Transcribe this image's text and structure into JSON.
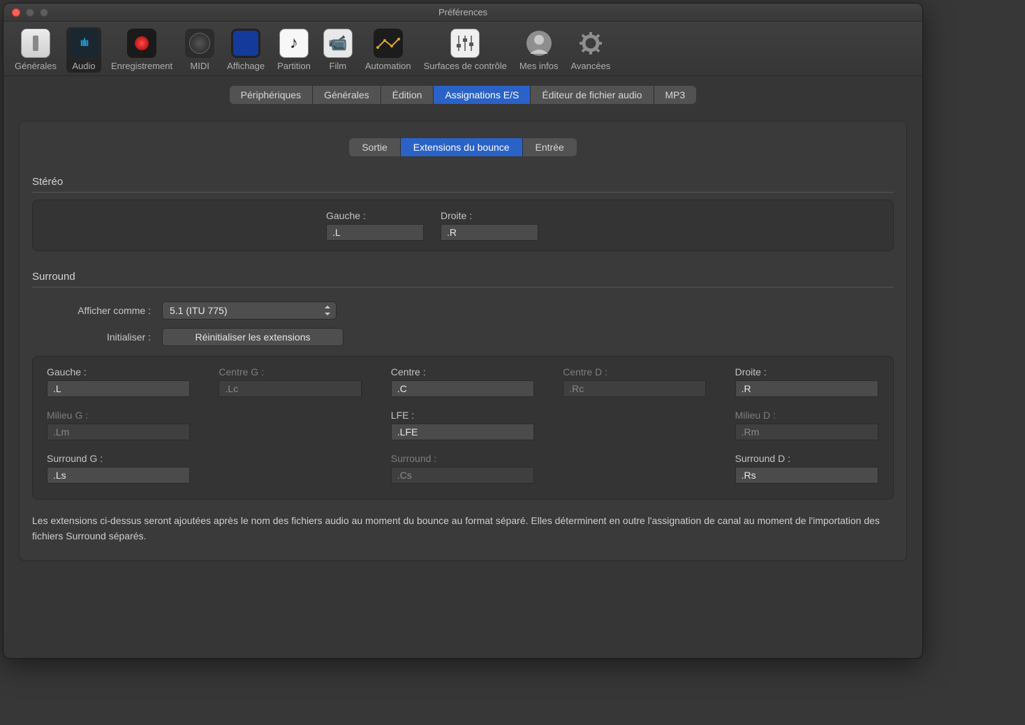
{
  "window": {
    "title": "Préférences"
  },
  "toolbar": {
    "items": [
      "Générales",
      "Audio",
      "Enregistrement",
      "MIDI",
      "Affichage",
      "Partition",
      "Film",
      "Automation",
      "Surfaces de contrôle",
      "Mes infos",
      "Avancées"
    ]
  },
  "tabs_top": [
    "Périphériques",
    "Générales",
    "Édition",
    "Assignations E/S",
    "Éditeur de fichier audio",
    "MP3"
  ],
  "tabs_top_selected": 3,
  "tabs_sub": [
    "Sortie",
    "Extensions du bounce",
    "Entrée"
  ],
  "tabs_sub_selected": 1,
  "stereo": {
    "title": "Stéréo",
    "left_label": "Gauche :",
    "left_value": ".L",
    "right_label": "Droite :",
    "right_value": ".R"
  },
  "surround": {
    "title": "Surround",
    "show_as_label": "Afficher comme :",
    "show_as_value": "5.1 (ITU 775)",
    "init_label": "Initialiser :",
    "init_button": "Réinitialiser les extensions",
    "fields": {
      "gauche": {
        "label": "Gauche :",
        "value": ".L",
        "dim": false
      },
      "centre_g": {
        "label": "Centre G :",
        "value": ".Lc",
        "dim": true
      },
      "centre": {
        "label": "Centre :",
        "value": ".C",
        "dim": false
      },
      "centre_d": {
        "label": "Centre D :",
        "value": ".Rc",
        "dim": true
      },
      "droite": {
        "label": "Droite :",
        "value": ".R",
        "dim": false
      },
      "milieu_g": {
        "label": "Milieu G :",
        "value": ".Lm",
        "dim": true
      },
      "lfe": {
        "label": "LFE :",
        "value": ".LFE",
        "dim": false
      },
      "milieu_d": {
        "label": "Milieu D :",
        "value": ".Rm",
        "dim": true
      },
      "surround_g": {
        "label": "Surround G :",
        "value": ".Ls",
        "dim": false
      },
      "surround": {
        "label": "Surround :",
        "value": ".Cs",
        "dim": true
      },
      "surround_d": {
        "label": "Surround D :",
        "value": ".Rs",
        "dim": false
      }
    }
  },
  "footnote": "Les extensions ci-dessus seront ajoutées après le nom des fichiers audio au moment du bounce au format séparé. Elles déterminent en outre l'assignation de canal au moment de l'importation des fichiers Surround séparés."
}
